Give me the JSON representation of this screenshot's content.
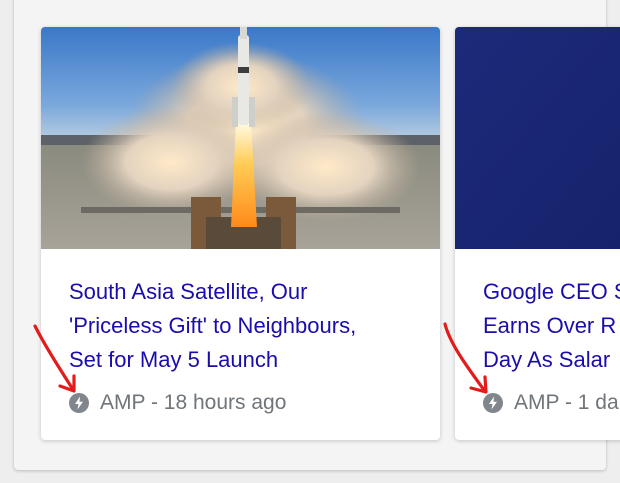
{
  "cards": [
    {
      "headline": "South Asia Satellite, Our\n'Priceless Gift' to Neighbours,\nSet for May 5 Launch",
      "meta": "AMP - 18 hours ago",
      "image": "rocket-launch-photo"
    },
    {
      "headline": "Google CEO S\nEarns Over R\nDay As Salar",
      "meta": "AMP - 1 da",
      "image": "blue-photo"
    }
  ],
  "icons": {
    "amp": "amp-lightning-icon",
    "annotation": "red-arrow"
  },
  "colors": {
    "link": "#1a0dab",
    "meta_text": "#70757a",
    "arrow": "#e21b1b",
    "card_bg": "#ffffff",
    "page_bg": "#eeeeee"
  }
}
